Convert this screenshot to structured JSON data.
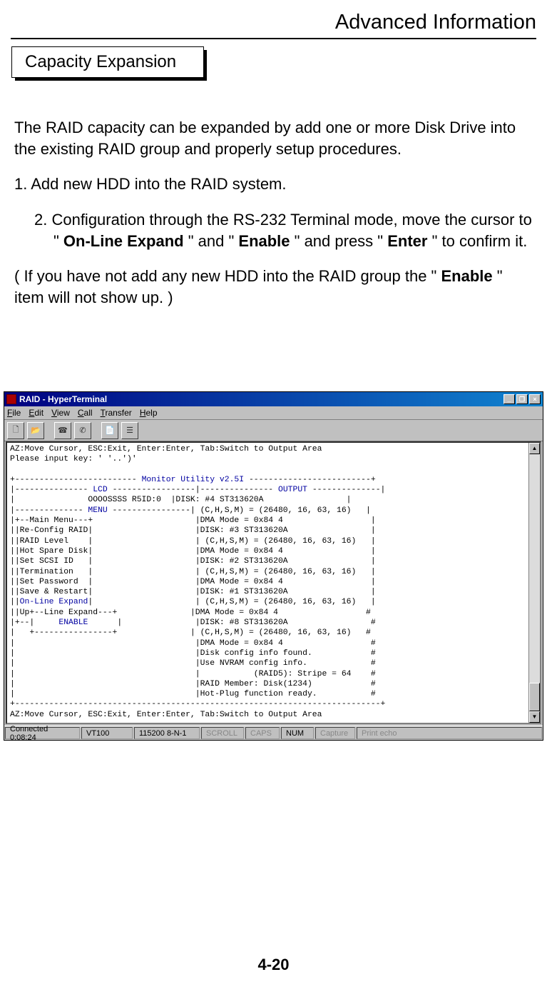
{
  "header": {
    "title": "Advanced Information"
  },
  "section": {
    "title": "Capacity Expansion"
  },
  "body": {
    "intro": "The RAID capacity can be expanded by add one or more Disk Drive into the existing RAID group and properly setup procedures.",
    "step1": "1. Add new HDD into the RAID system.",
    "step2_a": "2. Configuration through the RS-232 Terminal mode, move the cursor to \" ",
    "step2_b": "On-Line Expand",
    "step2_c": " \" and \" ",
    "step2_d": "Enable",
    "step2_e": " \" and press \" ",
    "step2_f": "Enter",
    "step2_g": " \" to confirm it.",
    "note_a": "( If you have not add any new HDD into the RAID group the \" ",
    "note_b": "Enable",
    "note_c": " \" item will not show up. )"
  },
  "terminal": {
    "title": "RAID - HyperTerminal",
    "menu": {
      "file": "File",
      "edit": "Edit",
      "view": "View",
      "call": "Call",
      "transfer": "Transfer",
      "help": "Help"
    },
    "status": {
      "connected": "Connected 0:08:24",
      "emulation": "VT100",
      "port": "115200 8-N-1",
      "scroll": "SCROLL",
      "caps": "CAPS",
      "num": "NUM",
      "capture": "Capture",
      "printecho": "Print echo"
    },
    "l00": "AZ:Move Cursor, ESC:Exit, Enter:Enter, Tab:Switch to Output Area",
    "l01": "Please input key: ' '..')'",
    "l02": "",
    "l03_a": "+------------------------- ",
    "l03_b": "Monitor Utility v2.5I",
    "l03_c": " -------------------------+",
    "l04_a": "|--------------- ",
    "l04_b": "LCD",
    "l04_c": " -----------------|--------------- ",
    "l04_d": "OUTPUT",
    "l04_e": " --------------|",
    "l05": "|               OOOOSSSS R5ID:0  |DISK: #4 ST313620A                 |",
    "l06_a": "|-------------- ",
    "l06_b": "MENU",
    "l06_c": " ----------------| (C,H,S,M) = (26480, 16, 63, 16)   |",
    "l07": "|+--Main Menu---+                     |DMA Mode = 0x84 4                  |",
    "l08": "||Re-Config RAID|                     |DISK: #3 ST313620A                 |",
    "l09": "||RAID Level    |                     | (C,H,S,M) = (26480, 16, 63, 16)   |",
    "l10": "||Hot Spare Disk|                     |DMA Mode = 0x84 4                  |",
    "l11": "||Set SCSI ID   |                     |DISK: #2 ST313620A                 |",
    "l12": "||Termination   |                     | (C,H,S,M) = (26480, 16, 63, 16)   |",
    "l13": "||Set Password  |                     |DMA Mode = 0x84 4                  |",
    "l14": "||Save & Restart|                     |DISK: #1 ST313620A                 |",
    "l15_a": "||",
    "l15_b": "On-Line Expand",
    "l15_c": "|                     | (C,H,S,M) = (26480, 16, 63, 16)   |",
    "l16": "||Up+--Line Expand---+               |DMA Mode = 0x84 4                  #",
    "l17_a": "|+--|     ",
    "l17_b": "ENABLE",
    "l17_c": "      |               |DISK: #8 ST313620A                 #",
    "l18": "|   +----------------+               | (C,H,S,M) = (26480, 16, 63, 16)   #",
    "l19": "|                                     |DMA Mode = 0x84 4                  #",
    "l20": "|                                     |Disk config info found.            #",
    "l21": "|                                     |Use NVRAM config info.             #",
    "l22": "|                                     |           (RAID5): Stripe = 64    #",
    "l23": "|                                     |RAID Member: Disk(1234)            #",
    "l24": "|                                     |Hot-Plug function ready.           #",
    "l25": "+---------------------------------------------------------------------------+",
    "l26": "AZ:Move Cursor, ESC:Exit, Enter:Enter, Tab:Switch to Output Area"
  },
  "footer": {
    "page_number": "4-20"
  }
}
